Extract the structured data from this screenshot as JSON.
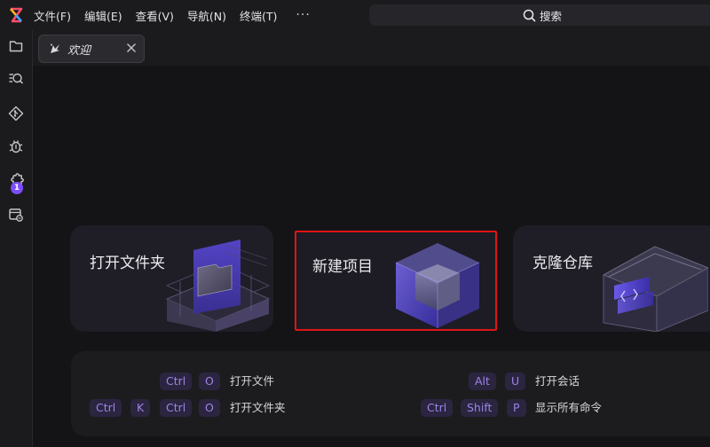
{
  "menubar": {
    "items": [
      "文件(F)",
      "编辑(E)",
      "查看(V)",
      "导航(N)",
      "终端(T)"
    ],
    "more": "···",
    "search_label": "搜索"
  },
  "activitybar": {
    "items": [
      "explorer-icon",
      "search-icon",
      "git-icon",
      "debug-icon",
      "extensions-icon",
      "remote-icon"
    ],
    "extensions_badge": "1"
  },
  "tabs": [
    {
      "label": "欢迎"
    }
  ],
  "welcome": {
    "cards": [
      {
        "label": "打开文件夹"
      },
      {
        "label": "新建项目"
      },
      {
        "label": "克隆仓库"
      }
    ],
    "shortcuts": [
      {
        "keys": [
          "Ctrl",
          "O"
        ],
        "label": "打开文件"
      },
      {
        "keys": [
          "Alt",
          "U"
        ],
        "label": "打开会话"
      },
      {
        "keys": [
          "Ctrl",
          "K",
          "Ctrl",
          "O"
        ],
        "label": "打开文件夹"
      },
      {
        "keys": [
          "Ctrl",
          "Shift",
          "P"
        ],
        "label": "显示所有命令"
      }
    ]
  },
  "colors": {
    "accent": "#7c4dff",
    "key_bg": "#2b2540",
    "key_text": "#9d84e6",
    "highlight_border": "#e01515"
  }
}
